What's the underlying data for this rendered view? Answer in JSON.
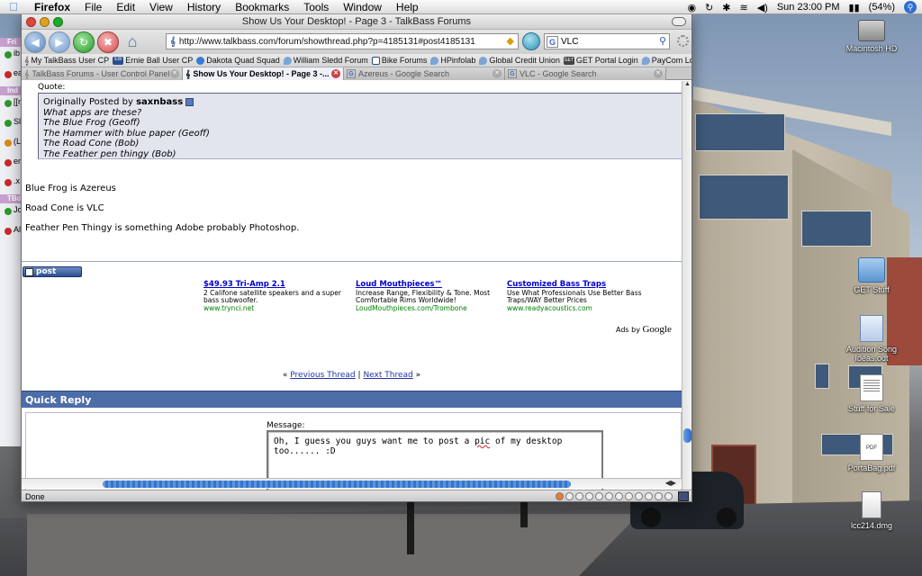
{
  "menubar": {
    "app_name": "Firefox",
    "items": [
      "File",
      "Edit",
      "View",
      "History",
      "Bookmarks",
      "Tools",
      "Window",
      "Help"
    ],
    "clock": "Sun 23:00 PM",
    "battery": "(54%)"
  },
  "window": {
    "title": "Show Us Your Desktop! - Page 3 - TalkBass Forums",
    "url": "http://www.talkbass.com/forum/showthread.php?p=4185131#post4185131",
    "search_value": "VLC"
  },
  "bookmarks": [
    "My TalkBass User CP",
    "Ernie Ball User CP",
    "Dakota Quad Squad",
    "William Sledd Forum",
    "Bike Forums",
    "HPinfolab",
    "Global Credit Union",
    "GET Portal Login",
    "PayCom Login"
  ],
  "bookmark_badges": {
    "ernie": "EB",
    "get": "GET"
  },
  "tabs": [
    {
      "label": "TalkBass Forums - User Control Panel"
    },
    {
      "label": "Show Us Your Desktop! - Page 3 -..."
    },
    {
      "label": "Azereus - Google Search"
    },
    {
      "label": "VLC - Google Search"
    }
  ],
  "post": {
    "quote_label": "Quote:",
    "quote_by_prefix": "Originally Posted by",
    "quote_author": "saxnbass",
    "quote_lines": [
      "What apps are these?",
      "The Blue Frog (Geoff)",
      "The Hammer with blue paper (Geoff)",
      "The Road Cone (Bob)",
      "The Feather pen thingy (Bob)"
    ],
    "lines": [
      "Blue Frog is Azereus",
      "Road Cone is VLC",
      "Feather Pen Thingy is something Adobe probably Photoshop."
    ],
    "reply_button": "post reply"
  },
  "ads": [
    {
      "title": "$49.93 Tri-Amp 2.1",
      "text": "2 Califone satellite speakers and a super bass subwoofer.",
      "url": "www.trynci.net"
    },
    {
      "title": "Loud Mouthpieces™",
      "text": "Increase Range, Flexibility & Tone. Most Comfortable Rims Worldwide!",
      "url": "LoudMouthpieces.com/Trombone"
    },
    {
      "title": "Customized Bass Traps",
      "text": "Use What Professionals Use Better Bass Traps/WAY Better Prices",
      "url": "www.readyacoustics.com"
    }
  ],
  "ads_by": "Ads by",
  "ads_by_brand": "Google",
  "thread_nav": {
    "prev": "Previous Thread",
    "sep": "|",
    "next": "Next Thread",
    "left": "«",
    "right": "»"
  },
  "quick_reply": {
    "title": "Quick Reply",
    "message_label": "Message:",
    "text_before": "Oh, I guess you guys want me to post a ",
    "text_misspelled": "pic",
    "text_after": " of my desktop too...... :D"
  },
  "status": "Done",
  "desktop_icons": [
    "Macintosh HD",
    "GET Stuff",
    "Audition Song Ideas.odt",
    "Stuff for Sale",
    "PortaBag.pdf",
    "lcc214.dmg"
  ],
  "pdf_badge": "PDF",
  "left_window": {
    "headers": [
      "Fri",
      "Ind",
      "TBd"
    ],
    "rows": [
      "ib",
      "ea",
      "[[n",
      "Sli",
      "(L)",
      "en",
      ".x",
      "Jo",
      "Al"
    ]
  }
}
